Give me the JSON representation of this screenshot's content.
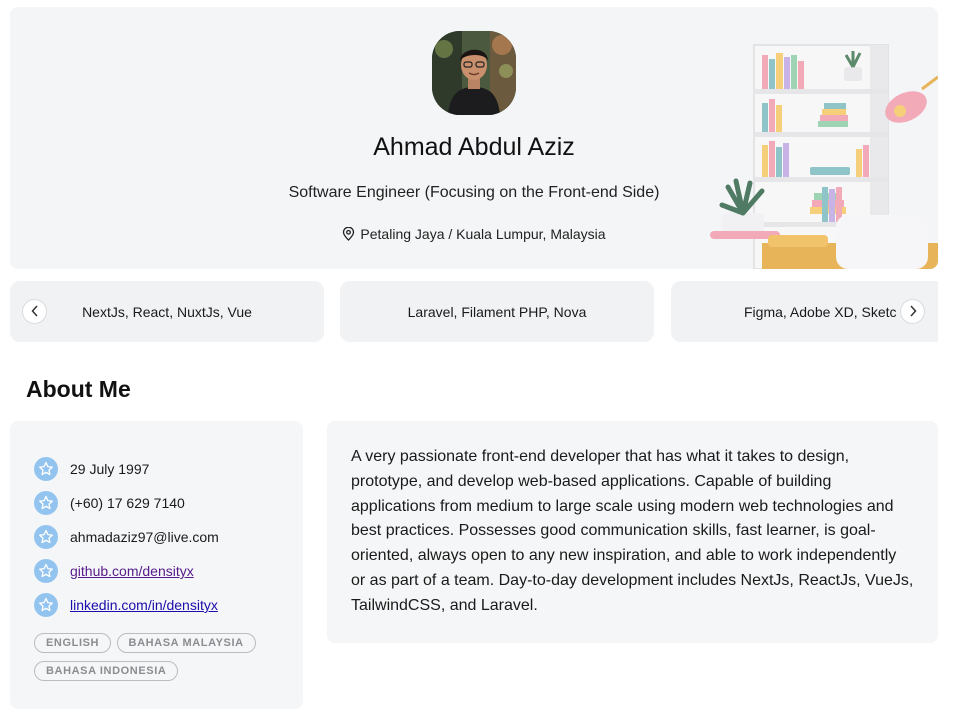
{
  "profile": {
    "name": "Ahmad Abdul Aziz",
    "title": "Software Engineer (Focusing on the Front-end Side)",
    "location": "Petaling Jaya / Kuala Lumpur, Malaysia"
  },
  "skills": {
    "items": [
      {
        "label": "NextJs, React, NuxtJs, Vue"
      },
      {
        "label": "Laravel, Filament PHP, Nova"
      },
      {
        "label": "Figma, Adobe XD, Sketc"
      }
    ],
    "prev_icon": "chevron-left-icon",
    "next_icon": "chevron-right-icon"
  },
  "about": {
    "heading": "About Me",
    "details": {
      "birthdate": "29 July 1997",
      "phone": "(+60) 17 629 7140",
      "email": "ahmadaziz97@live.com",
      "github": "github.com/densityx",
      "linkedin": "linkedin.com/in/densityx"
    },
    "languages": [
      "ENGLISH",
      "BAHASA MALAYSIA",
      "BAHASA INDONESIA"
    ],
    "bio": "A very passionate front-end developer that has what it takes to design, prototype, and develop web-based applications. Capable of building applications from medium to large scale using modern web technologies and best practices. Possesses good communication skills, fast learner, is goal-oriented, always open to any new inspiration, and able to work independently or as part of a team. Day-to-day development includes NextJs, ReactJs, VueJs, TailwindCSS, and Laravel."
  },
  "colors": {
    "card_bg": "#f4f5f6",
    "star_badge": "#93c4f0",
    "visited_link": "#551a8b",
    "link": "#1a0dab"
  }
}
